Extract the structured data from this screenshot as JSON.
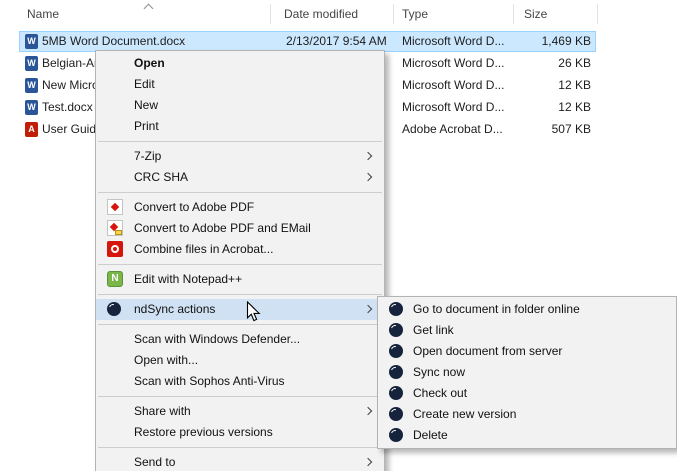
{
  "header": {
    "columns": [
      "Name",
      "Date modified",
      "Type",
      "Size"
    ],
    "sort": {
      "column": "Name",
      "direction": "ascending"
    }
  },
  "files": {
    "rows": [
      {
        "name": "5MB Word Document.docx",
        "date": "2/13/2017 9:54 AM",
        "type": "Microsoft Word D...",
        "size": "1,469 KB",
        "icon": "word-document-icon",
        "selected": true
      },
      {
        "name": "Belgian-Am",
        "date": "",
        "type": "Microsoft Word D...",
        "size": "26 KB",
        "icon": "word-document-icon",
        "selected": false
      },
      {
        "name": "New Micro",
        "date": "",
        "type": "Microsoft Word D...",
        "size": "12 KB",
        "icon": "word-document-icon",
        "selected": false
      },
      {
        "name": "Test.docx",
        "date": "",
        "type": "Microsoft Word D...",
        "size": "12 KB",
        "icon": "word-document-icon",
        "selected": false
      },
      {
        "name": "User Guide",
        "date": "",
        "type": "Adobe Acrobat D...",
        "size": "507 KB",
        "icon": "pdf-document-icon",
        "selected": false
      }
    ]
  },
  "context_menu": {
    "items": [
      {
        "label": "Open",
        "bold": true
      },
      {
        "label": "Edit"
      },
      {
        "label": "New"
      },
      {
        "label": "Print"
      },
      {
        "label": "7-Zip",
        "has_submenu": true
      },
      {
        "label": "CRC SHA",
        "has_submenu": true
      },
      {
        "label": "Convert to Adobe PDF",
        "icon": "adobe-pdf-icon"
      },
      {
        "label": "Convert to Adobe PDF and EMail",
        "icon": "adobe-pdf-mail-icon"
      },
      {
        "label": "Combine files in Acrobat...",
        "icon": "acrobat-icon"
      },
      {
        "label": "Edit with Notepad++",
        "icon": "notepad-plus-plus-icon"
      },
      {
        "label": "ndSync actions",
        "icon": "ndsync-icon",
        "has_submenu": true,
        "highlighted": true
      },
      {
        "label": "Scan with Windows Defender..."
      },
      {
        "label": "Open with..."
      },
      {
        "label": "Scan with Sophos Anti-Virus"
      },
      {
        "label": "Share with",
        "has_submenu": true
      },
      {
        "label": "Restore previous versions"
      },
      {
        "label": "Send to",
        "has_submenu": true
      }
    ]
  },
  "submenu": {
    "parent": "ndSync actions",
    "items": [
      {
        "label": "Go to document in folder online",
        "icon": "ndsync-icon"
      },
      {
        "label": "Get link",
        "icon": "ndsync-icon"
      },
      {
        "label": "Open document from server",
        "icon": "ndsync-icon"
      },
      {
        "label": "Sync now",
        "icon": "ndsync-icon"
      },
      {
        "label": "Check out",
        "icon": "ndsync-icon"
      },
      {
        "label": "Create new version",
        "icon": "ndsync-icon"
      },
      {
        "label": "Delete",
        "icon": "ndsync-icon"
      }
    ]
  },
  "colors": {
    "selection_bg": "#cce8ff",
    "selection_border": "#99d1ff",
    "menu_bg": "#f2f2f2",
    "menu_highlight": "#cfe1f2",
    "word_icon": "#2a5699",
    "pdf_icon": "#d6160c",
    "ndsync_icon": "#16233c",
    "notepad_icon": "#7ab648"
  }
}
